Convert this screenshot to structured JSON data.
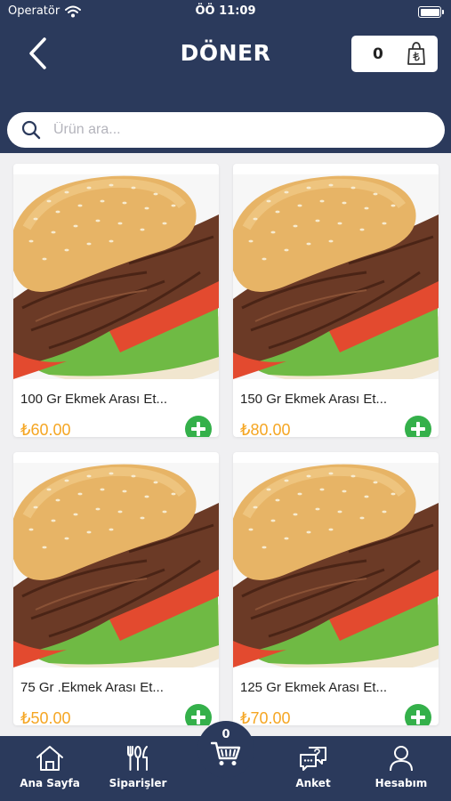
{
  "status_bar": {
    "carrier": "Operatör",
    "time": "ÖÖ 11:09"
  },
  "header": {
    "title": "DÖNER",
    "cart_count": "0"
  },
  "search": {
    "placeholder": "Ürün ara..."
  },
  "products": [
    {
      "name": "100 Gr Ekmek Arası Et...",
      "price": "₺60.00"
    },
    {
      "name": "150 Gr Ekmek Arası Et...",
      "price": "₺80.00"
    },
    {
      "name": "75 Gr .Ekmek Arası Et...",
      "price": "₺50.00"
    },
    {
      "name": "125 Gr Ekmek Arası Et...",
      "price": "₺70.00"
    }
  ],
  "tabbar": {
    "home": "Ana Sayfa",
    "orders": "Siparişler",
    "cart_count": "0",
    "survey": "Anket",
    "account": "Hesabım"
  },
  "colors": {
    "header_bg": "#2b3a5c",
    "price": "#f5a623",
    "add_button": "#34b04a"
  },
  "icons": [
    "wifi-icon",
    "battery-icon",
    "back-chevron-icon",
    "shopping-bag-icon",
    "search-icon",
    "plus-icon",
    "home-icon",
    "cutlery-icon",
    "cart-icon",
    "chat-question-icon",
    "user-icon"
  ]
}
